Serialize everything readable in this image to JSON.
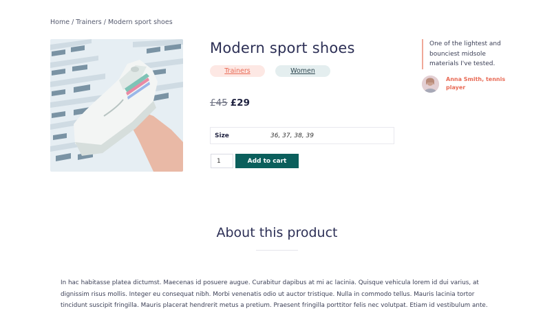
{
  "breadcrumb": {
    "home": "Home",
    "category": "Trainers",
    "current": "Modern sport shoes",
    "separator": "/"
  },
  "product": {
    "title": "Modern sport shoes",
    "image_icon": "product-photo-sneaker",
    "tags": [
      "Trainers",
      "Women"
    ],
    "price_old": "£45",
    "price_new": "£29",
    "attributes": {
      "size_label": "Size",
      "size_value": "36, 37, 38, 39"
    },
    "quantity": "1",
    "add_to_cart_label": "Add to cart"
  },
  "testimonial": {
    "quote": "One of the lightest and bounciest midsole materials I've tested.",
    "author": "Anna Smith, tennis player"
  },
  "about": {
    "title": "About this product",
    "text": "In hac habitasse platea dictumst. Maecenas id posuere augue. Curabitur dapibus at mi ac lacinia. Quisque vehicula lorem id dui varius, at dignissim risus mollis. Integer eu consequat nibh. Morbi venenatis odio ut auctor tristique. Nulla in commodo tellus. Mauris lacinia tortor tincidunt suscipit fringilla. Mauris placerat hendrerit metus a pretium. Praesent fringilla porttitor felis nec volutpat. Etiam id vestibulum ante. Maecenas porttitor"
  },
  "colors": {
    "accent": "#0b5f5c",
    "tag_trainers_bg": "#fde8e4",
    "tag_trainers_text": "#e86a55",
    "tag_women_bg": "#e4eeef",
    "heading": "#2c2f55"
  }
}
